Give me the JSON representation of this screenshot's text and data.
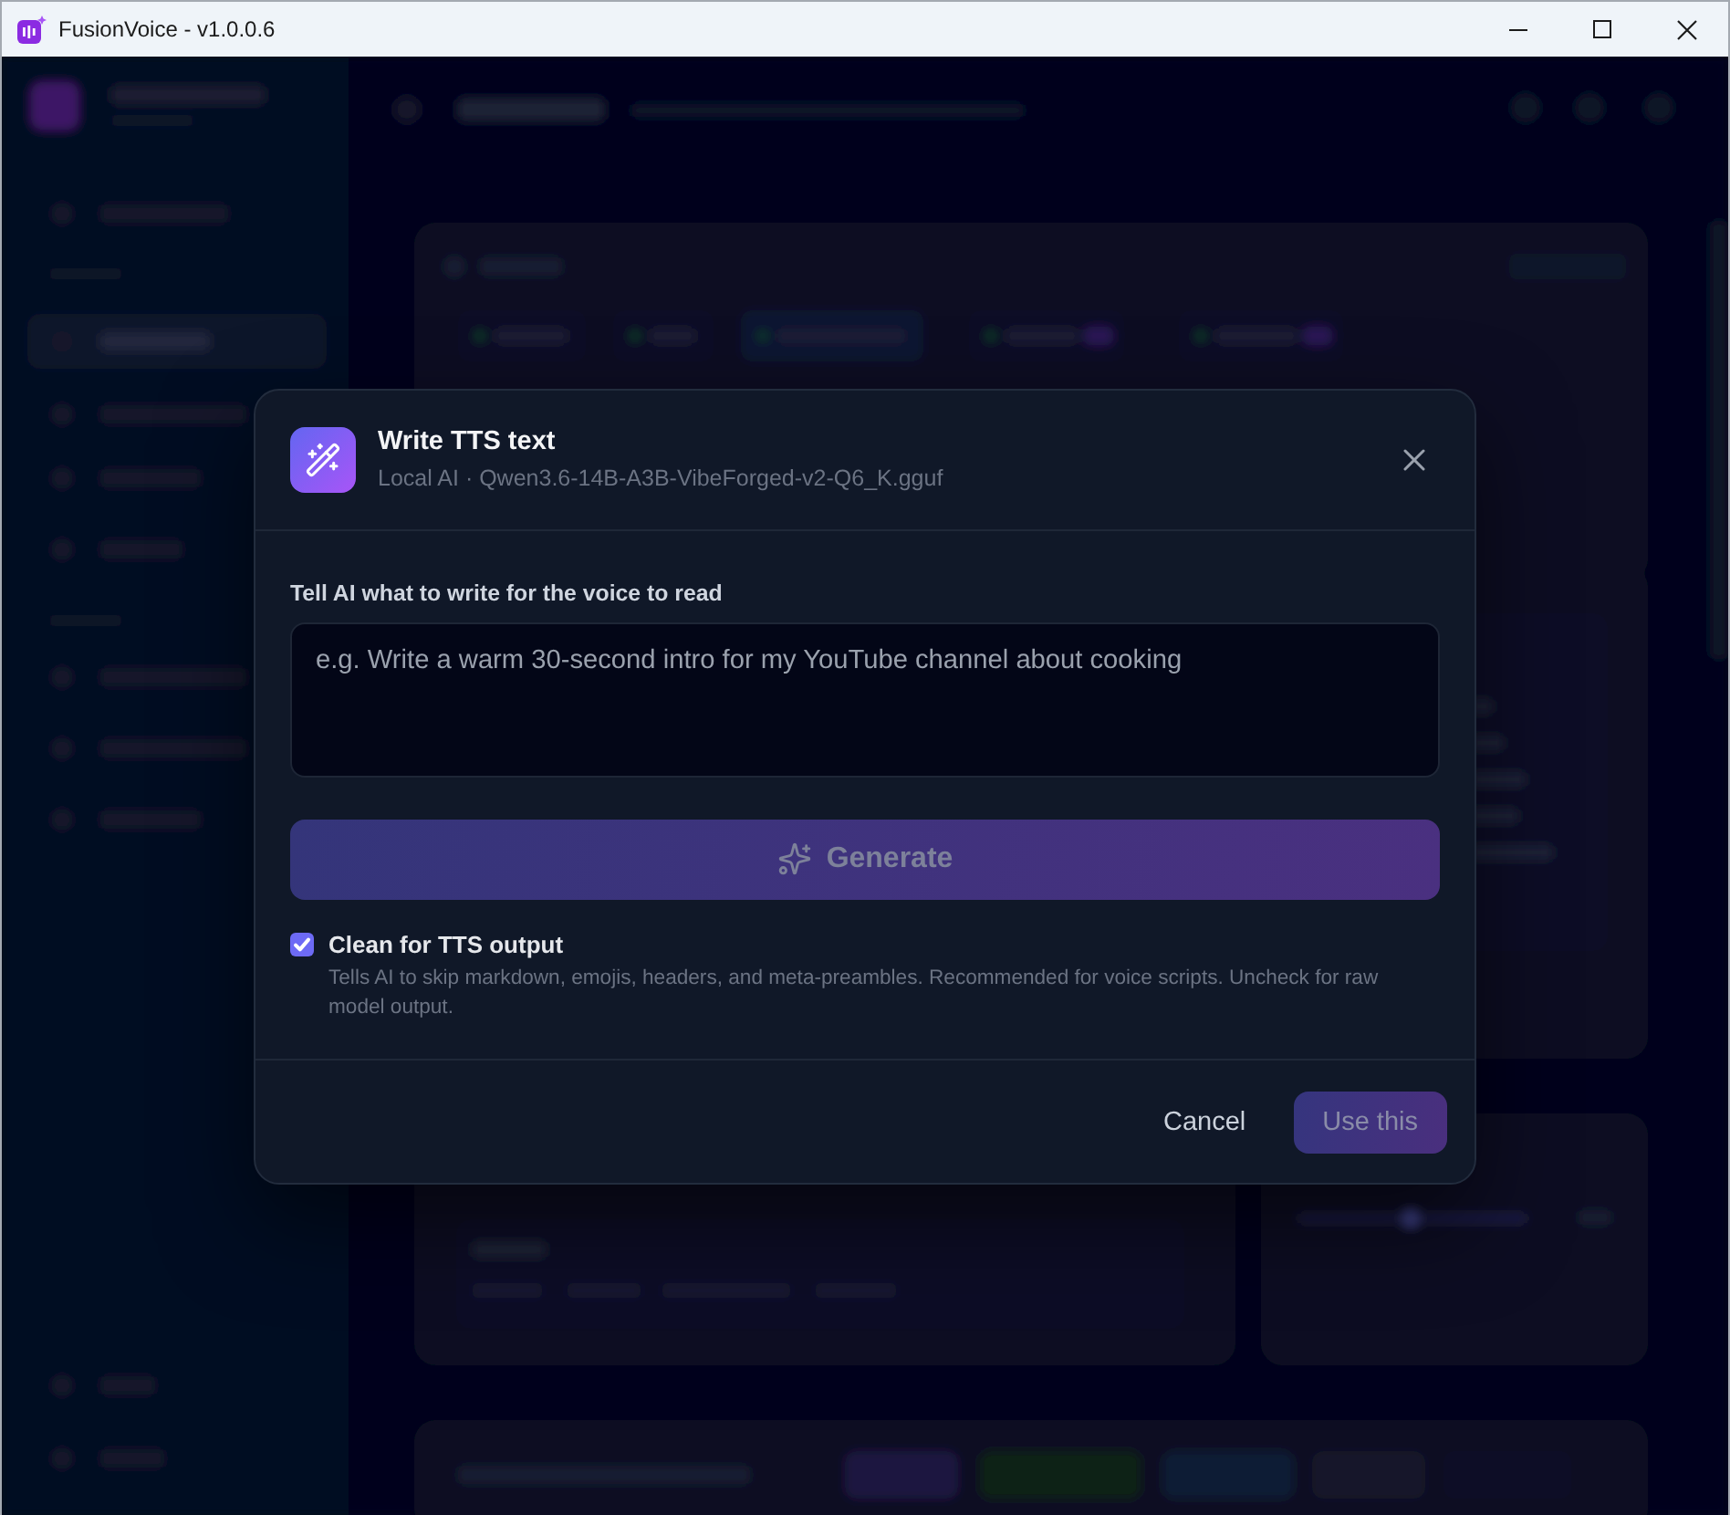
{
  "window": {
    "title": "FusionVoice - v1.0.0.6"
  },
  "dialog": {
    "title": "Write TTS text",
    "subtitle": "Local AI · Qwen3.6-14B-A3B-VibeForged-v2-Q6_K.gguf",
    "prompt": {
      "label": "Tell AI what to write for the voice to read",
      "placeholder": "e.g. Write a warm 30-second intro for my YouTube channel about cooking"
    },
    "generate_button": {
      "label": "Generate",
      "disabled": true
    },
    "option": {
      "label": "Clean for TTS output",
      "description": "Tells AI to skip markdown, emojis, headers, and meta-preambles. Recommended for voice scripts. Uncheck for raw model output.",
      "checked": true
    },
    "buttons": [
      {
        "kind": "text",
        "label": "Cancel",
        "disabled": false
      },
      {
        "kind": "primary",
        "label": "Use this",
        "disabled": true
      }
    ]
  }
}
